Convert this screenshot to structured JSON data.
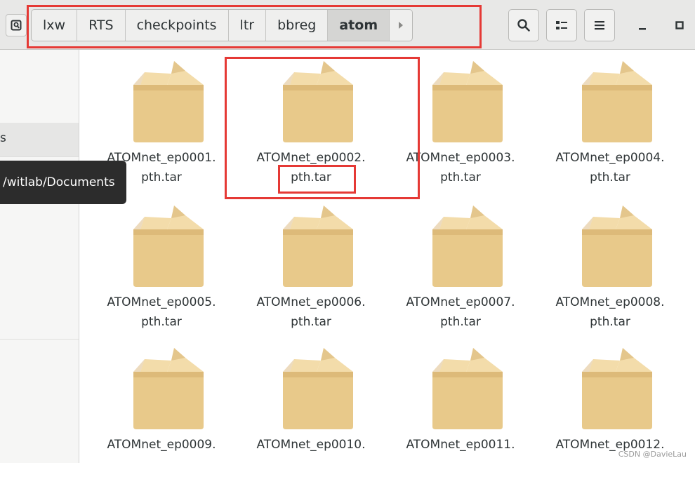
{
  "breadcrumbs": [
    "lxw",
    "RTS",
    "checkpoints",
    "ltr",
    "bbreg",
    "atom"
  ],
  "active_crumb": "atom",
  "icons": {
    "location": "location-toggle-icon",
    "forward": "chevron-right-icon",
    "search": "search-icon",
    "view_toggle": "list-view-icon",
    "menu": "hamburger-menu-icon",
    "minimize": "minimize-icon",
    "maximize": "maximize-icon",
    "file": "package-archive-icon"
  },
  "sidebar": {
    "selected_label": "s",
    "tooltip": "/witlab/Documents"
  },
  "files": [
    {
      "line1": "ATOMnet_ep0001.",
      "line2": "pth.tar"
    },
    {
      "line1": "ATOMnet_ep0002.",
      "line2": "pth.tar"
    },
    {
      "line1": "ATOMnet_ep0003.",
      "line2": "pth.tar"
    },
    {
      "line1": "ATOMnet_ep0004.",
      "line2": "pth.tar"
    },
    {
      "line1": "ATOMnet_ep0005.",
      "line2": "pth.tar"
    },
    {
      "line1": "ATOMnet_ep0006.",
      "line2": "pth.tar"
    },
    {
      "line1": "ATOMnet_ep0007.",
      "line2": "pth.tar"
    },
    {
      "line1": "ATOMnet_ep0008.",
      "line2": "pth.tar"
    },
    {
      "line1": "ATOMnet_ep0009.",
      "line2": ""
    },
    {
      "line1": "ATOMnet_ep0010.",
      "line2": ""
    },
    {
      "line1": "ATOMnet_ep0011.",
      "line2": ""
    },
    {
      "line1": "ATOMnet_ep0012.",
      "line2": ""
    }
  ],
  "watermark": "CSDN @DavieLau",
  "colors": {
    "annotation": "#e53935",
    "box_light": "#f3dcaa",
    "box_mid": "#e8c98a",
    "box_dark": "#d6b06e"
  }
}
